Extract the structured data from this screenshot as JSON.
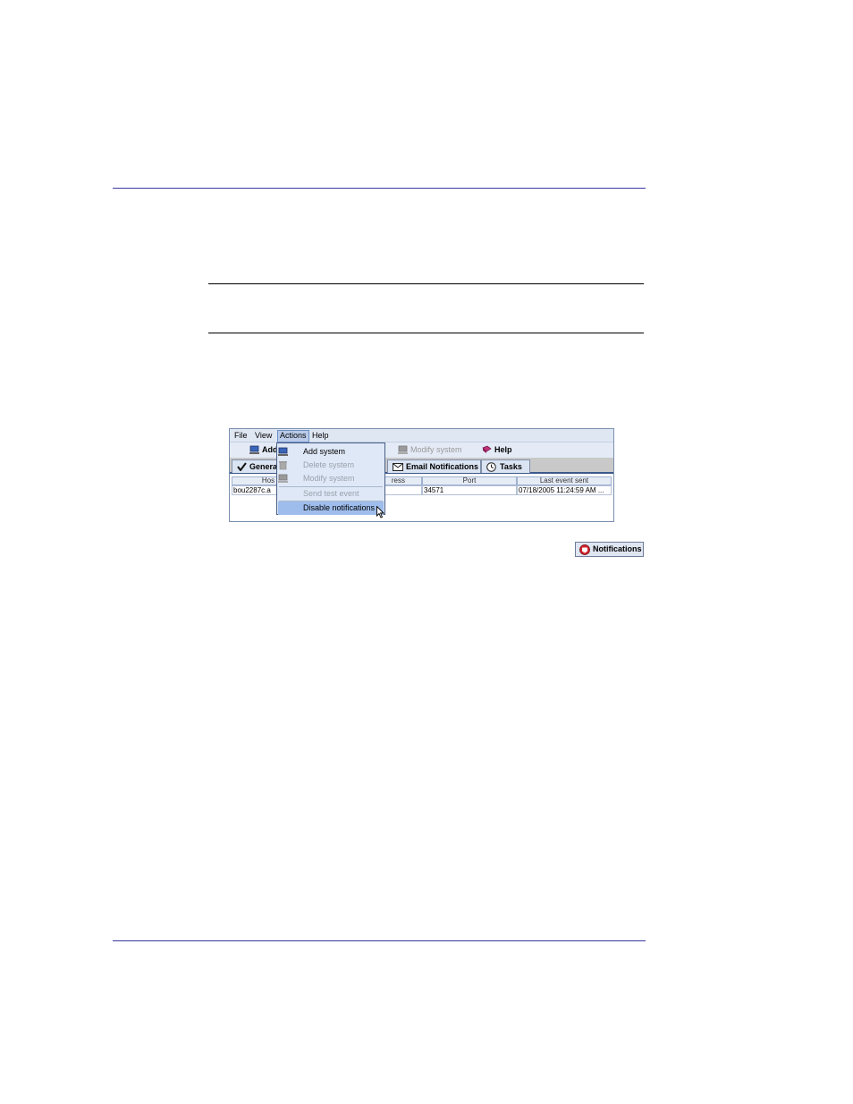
{
  "menubar": {
    "items": [
      "File",
      "View",
      "Actions",
      "Help"
    ]
  },
  "toolbar": {
    "add_label": "Add",
    "modify_label": "Modify system",
    "help_label": "Help"
  },
  "tabs": {
    "general": "Genera",
    "email": "Email Notifications",
    "tasks": "Tasks"
  },
  "table": {
    "columns": [
      "Hos",
      "ress",
      "Port",
      "Last event sent"
    ],
    "rows": [
      [
        "bou2287c.a",
        "",
        "34571",
        "07/18/2005 11:24:59 AM ..."
      ]
    ]
  },
  "actions_menu": {
    "add_system": "Add system",
    "delete_system": "Delete system",
    "modify_system": "Modify system",
    "send_test_event": "Send test event",
    "disable_notifications": "Disable notifications"
  },
  "notifications_button": "Notifications",
  "colors": {
    "rule_blue": "#3a3aa0",
    "menu_highlight": "#9fbdec",
    "tab_border": "#3c5a8c"
  }
}
